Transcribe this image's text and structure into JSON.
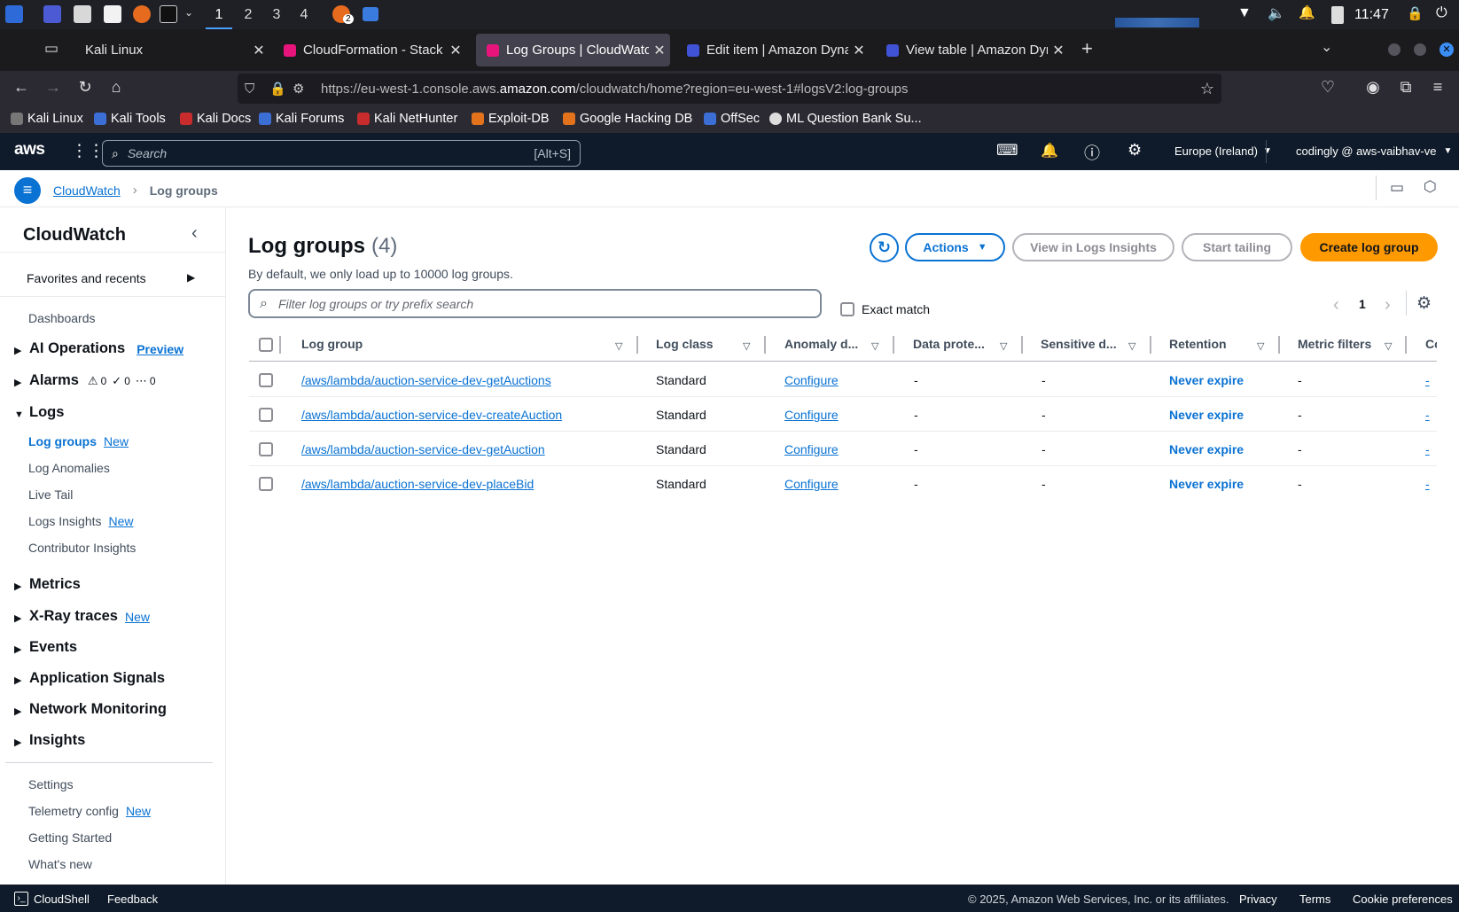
{
  "os": {
    "workspaces": [
      "1",
      "2",
      "3",
      "4"
    ],
    "active_workspace": "1",
    "clock": "11:47",
    "firefox_badge": "2"
  },
  "tabs": [
    {
      "label": "Kali Linux",
      "icon": "kali-icon"
    },
    {
      "label": "CloudFormation - Stack a",
      "icon": "cloudformation-icon"
    },
    {
      "label": "Log Groups | CloudWatch",
      "icon": "cloudwatch-icon"
    },
    {
      "label": "Edit item | Amazon Dynam",
      "icon": "dynamodb-icon"
    },
    {
      "label": "View table | Amazon Dyna",
      "icon": "dynamodb-icon"
    }
  ],
  "url": {
    "prefix": "https://eu-west-1.console.aws.",
    "domain": "amazon.com",
    "path": "/cloudwatch/home?region=eu-west-1#logsV2:log-groups"
  },
  "bookmarks": [
    "Kali Linux",
    "Kali Tools",
    "Kali Docs",
    "Kali Forums",
    "Kali NetHunter",
    "Exploit-DB",
    "Google Hacking DB",
    "OffSec",
    "ML Question Bank Su..."
  ],
  "aws_header": {
    "logo": "aws",
    "search_placeholder": "Search",
    "search_shortcut": "[Alt+S]",
    "region": "Europe (Ireland)",
    "account": "codingly @ aws-vaibhav-ve"
  },
  "breadcrumb": {
    "root": "CloudWatch",
    "current": "Log groups"
  },
  "sidebar": {
    "title": "CloudWatch",
    "favorites": "Favorites and recents",
    "dashboards": "Dashboards",
    "ai_ops": "AI Operations",
    "ai_ops_tag": "Preview",
    "alarms": "Alarms",
    "alarm_counts": [
      "0",
      "0",
      "0"
    ],
    "logs": "Logs",
    "logs_items": [
      {
        "label": "Log groups",
        "tag": "New"
      },
      {
        "label": "Log Anomalies",
        "tag": ""
      },
      {
        "label": "Live Tail",
        "tag": ""
      },
      {
        "label": "Logs Insights",
        "tag": "New"
      },
      {
        "label": "Contributor Insights",
        "tag": ""
      }
    ],
    "metrics": "Metrics",
    "xray": "X-Ray traces",
    "xray_tag": "New",
    "events": "Events",
    "app_signals": "Application Signals",
    "network": "Network Monitoring",
    "insights": "Insights",
    "settings": "Settings",
    "telemetry": "Telemetry config",
    "telemetry_tag": "New",
    "getting_started": "Getting Started",
    "whats_new": "What's new"
  },
  "main": {
    "title": "Log groups",
    "count": "(4)",
    "subtitle": "By default, we only load up to 10000 log groups.",
    "actions_label": "Actions",
    "view_insights_label": "View in Logs Insights",
    "start_tailing_label": "Start tailing",
    "create_label": "Create log group",
    "filter_placeholder": "Filter log groups or try prefix search",
    "exact_match": "Exact match",
    "page": "1",
    "columns": [
      "Log group",
      "Log class",
      "Anomaly d...",
      "Data prote...",
      "Sensitive d...",
      "Retention",
      "Metric filters",
      "Co"
    ],
    "rows": [
      {
        "name": "/aws/lambda/auction-service-dev-getAuctions",
        "class": "Standard",
        "anomaly": "Configure",
        "data_prot": "-",
        "sensitive": "-",
        "retention": "Never expire",
        "metric": "-",
        "contrib": "-"
      },
      {
        "name": "/aws/lambda/auction-service-dev-createAuction",
        "class": "Standard",
        "anomaly": "Configure",
        "data_prot": "-",
        "sensitive": "-",
        "retention": "Never expire",
        "metric": "-",
        "contrib": "-"
      },
      {
        "name": "/aws/lambda/auction-service-dev-getAuction",
        "class": "Standard",
        "anomaly": "Configure",
        "data_prot": "-",
        "sensitive": "-",
        "retention": "Never expire",
        "metric": "-",
        "contrib": "-"
      },
      {
        "name": "/aws/lambda/auction-service-dev-placeBid",
        "class": "Standard",
        "anomaly": "Configure",
        "data_prot": "-",
        "sensitive": "-",
        "retention": "Never expire",
        "metric": "-",
        "contrib": "-"
      }
    ]
  },
  "footer": {
    "cloudshell": "CloudShell",
    "feedback": "Feedback",
    "copyright": "© 2025, Amazon Web Services, Inc. or its affiliates.",
    "privacy": "Privacy",
    "terms": "Terms",
    "cookies": "Cookie preferences"
  }
}
